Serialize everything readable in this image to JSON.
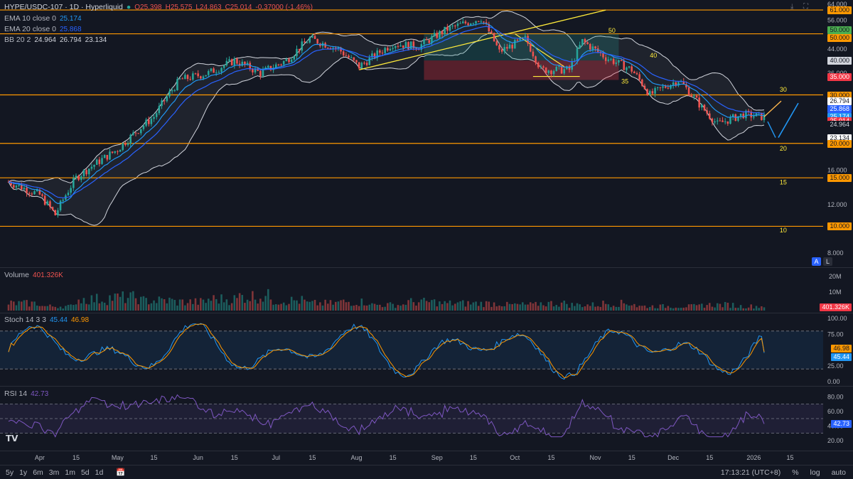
{
  "header": {
    "symbol": "HYPE/USDC-107 · 1D · Hyperliquid",
    "ohlc": {
      "o": "O25.398",
      "h": "H25.575",
      "l": "L24.863",
      "c": "C25.014",
      "chg": "-0.37000 (-1.46%)"
    },
    "ema10": {
      "label": "EMA 10 close 0",
      "value": "25.174"
    },
    "ema20": {
      "label": "EMA 20 close 0",
      "value": "25.868"
    },
    "bb": {
      "label": "BB 20 2",
      "basis": "24.964",
      "upper": "26.794",
      "lower": "23.134"
    }
  },
  "volume_legend": {
    "label": "Volume",
    "value": "401.326K"
  },
  "stoch_legend": {
    "label": "Stoch 14 3 3",
    "k": "45.44",
    "d": "46.98"
  },
  "rsi_legend": {
    "label": "RSI 14",
    "value": "42.73"
  },
  "price_axis": [
    "64.000",
    "60.000",
    "56.000",
    "52.000",
    "48.000",
    "44.000",
    "36.000",
    "16.000",
    "12.000",
    "8.000"
  ],
  "level_tags": [
    {
      "text": "61.000",
      "bg": "#ff9800",
      "fg": "#131722"
    },
    {
      "text": "50.000",
      "bg": "#4caf50",
      "fg": "#131722"
    },
    {
      "text": "50.000",
      "bg": "#ff9800",
      "fg": "#131722"
    },
    {
      "text": "40.000",
      "bg": "#d1d4dc",
      "fg": "#131722"
    },
    {
      "text": "35.000",
      "bg": "#f23645",
      "fg": "#ffffff"
    },
    {
      "text": "30.000",
      "bg": "#ff9800",
      "fg": "#131722"
    },
    {
      "text": "26.794",
      "bg": "#ffffff",
      "fg": "#131722"
    },
    {
      "text": "25.868",
      "bg": "#2962ff",
      "fg": "#ffffff"
    },
    {
      "text": "25.174",
      "bg": "#2196f3",
      "fg": "#ffffff"
    },
    {
      "text": "25.014",
      "bg": "#f23645",
      "fg": "#ffffff"
    },
    {
      "text": "24.964",
      "bg": "#131722",
      "fg": "#d1d4dc"
    },
    {
      "text": "23.134",
      "bg": "#ffffff",
      "fg": "#131722"
    },
    {
      "text": "20.000",
      "bg": "#ff9800",
      "fg": "#131722"
    },
    {
      "text": "15.000",
      "bg": "#ff9800",
      "fg": "#131722"
    },
    {
      "text": "10.000",
      "bg": "#ff9800",
      "fg": "#131722"
    }
  ],
  "annotations": [
    "50",
    "40",
    "35",
    "30",
    "20",
    "15",
    "10"
  ],
  "volume_axis": [
    "20M",
    "10M"
  ],
  "volume_tag": "401.326K",
  "stoch_axis": [
    "100.00",
    "75.00",
    "25.00",
    "0.00"
  ],
  "stoch_tags": [
    "46.98",
    "45.44"
  ],
  "rsi_axis": [
    "80.00",
    "60.00",
    "40.00",
    "20.00"
  ],
  "rsi_tag": "42.73",
  "x_axis": [
    "Apr",
    "15",
    "May",
    "15",
    "Jun",
    "15",
    "Jul",
    "15",
    "Aug",
    "15",
    "Sep",
    "15",
    "Oct",
    "15",
    "Nov",
    "15",
    "Dec",
    "15",
    "2026",
    "15"
  ],
  "bottom_bar": {
    "ranges": [
      "5y",
      "1y",
      "6m",
      "3m",
      "1m",
      "5d",
      "1d"
    ],
    "time": "17:13:21 (UTC+8)",
    "pct": "%",
    "log": "log",
    "auto": "auto"
  },
  "colors": {
    "bg": "#131722",
    "up": "#26a69a",
    "down": "#ef5350",
    "level": "#ff9800",
    "ema10": "#2196f3",
    "ema20": "#2962ff",
    "bb": "#d1d4dc",
    "trend": "#ffeb3b"
  },
  "chart_data": {
    "type": "candlestick",
    "title": "HYPE/USDC-107 · 1D · Hyperliquid",
    "x_range": [
      "2025-03-20",
      "2026-01-05"
    ],
    "y_range": [
      8,
      64
    ],
    "horizontal_levels": [
      61,
      50,
      30,
      20,
      15,
      10
    ],
    "close_points": [
      {
        "date": "Mar 20",
        "close": 14.5
      },
      {
        "date": "Apr 1",
        "close": 13.0
      },
      {
        "date": "Apr 7",
        "close": 11.0
      },
      {
        "date": "Apr 15",
        "close": 15.0
      },
      {
        "date": "May 1",
        "close": 19.0
      },
      {
        "date": "May 15",
        "close": 25.0
      },
      {
        "date": "May 25",
        "close": 34.0
      },
      {
        "date": "Jun 5",
        "close": 36.0
      },
      {
        "date": "Jun 15",
        "close": 40.0
      },
      {
        "date": "Jun 25",
        "close": 36.0
      },
      {
        "date": "Jul 5",
        "close": 40.0
      },
      {
        "date": "Jul 14",
        "close": 48.0
      },
      {
        "date": "Jul 25",
        "close": 44.0
      },
      {
        "date": "Aug 2",
        "close": 38.0
      },
      {
        "date": "Aug 15",
        "close": 46.0
      },
      {
        "date": "Aug 25",
        "close": 45.0
      },
      {
        "date": "Sep 5",
        "close": 52.0
      },
      {
        "date": "Sep 18",
        "close": 57.0
      },
      {
        "date": "Sep 25",
        "close": 43.0
      },
      {
        "date": "Oct 5",
        "close": 48.0
      },
      {
        "date": "Oct 11",
        "close": 37.0
      },
      {
        "date": "Oct 22",
        "close": 37.0
      },
      {
        "date": "Oct 27",
        "close": 47.0
      },
      {
        "date": "Nov 5",
        "close": 41.0
      },
      {
        "date": "Nov 15",
        "close": 37.0
      },
      {
        "date": "Nov 22",
        "close": 30.0
      },
      {
        "date": "Dec 3",
        "close": 34.0
      },
      {
        "date": "Dec 12",
        "close": 27.0
      },
      {
        "date": "Dec 18",
        "close": 23.5
      },
      {
        "date": "Dec 28",
        "close": 25.5
      },
      {
        "date": "Jan 4",
        "close": 25.0
      }
    ],
    "volume_points": [
      5,
      3,
      8,
      9,
      7,
      6,
      8,
      10,
      7,
      5,
      6,
      4,
      6,
      5,
      5,
      4,
      5,
      4,
      5,
      3,
      3,
      4,
      3
    ],
    "stoch": {
      "k": 45.44,
      "d": 46.98,
      "bands": [
        80,
        20
      ]
    },
    "rsi": {
      "value": 42.73,
      "bands": [
        70,
        30
      ]
    }
  }
}
